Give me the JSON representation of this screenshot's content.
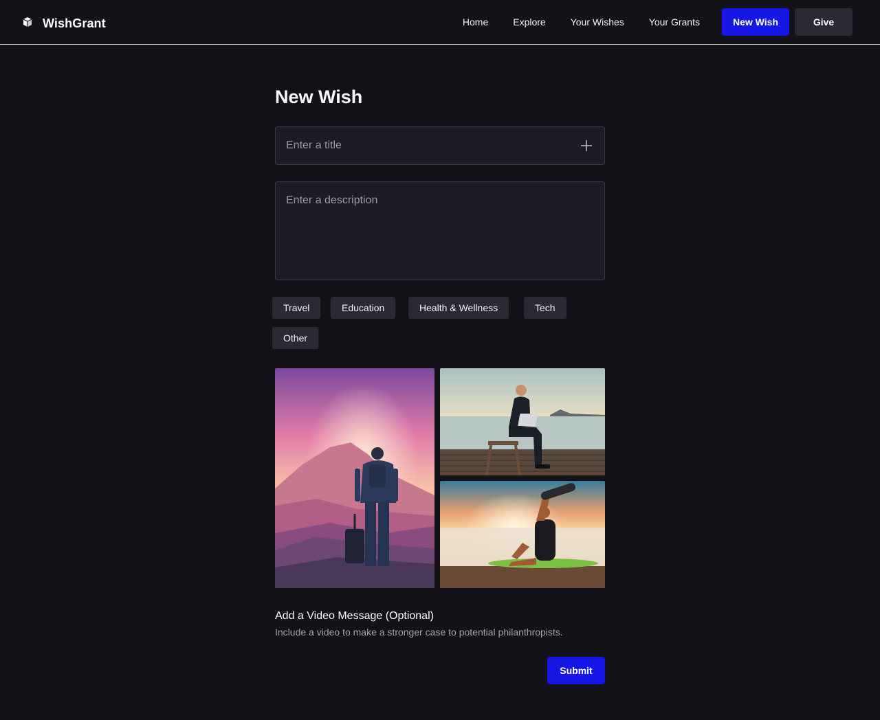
{
  "app": {
    "name": "WishGrant"
  },
  "nav": {
    "links": [
      "Home",
      "Explore",
      "Your Wishes",
      "Your Grants"
    ],
    "new_wish": "New Wish",
    "give": "Give"
  },
  "form": {
    "heading": "New Wish",
    "title_placeholder": "Enter a title",
    "title_value": "",
    "description_placeholder": "Enter a description",
    "description_value": ""
  },
  "categories": [
    "Travel",
    "Education",
    "Health & Wellness",
    "Tech",
    "Other"
  ],
  "images": [
    "traveler-on-mountain-at-sunset",
    "man-with-laptop-on-pier",
    "person-exercising-on-yoga-mat-at-sunset"
  ],
  "video": {
    "title": "Add a Video Message (Optional)",
    "description": "Include a video to make a stronger case to potential philanthropists."
  },
  "submit_label": "Submit",
  "colors": {
    "background": "#131218",
    "primary": "#1616e6",
    "secondary": "#2a2a36",
    "field": "#1d1c26"
  }
}
